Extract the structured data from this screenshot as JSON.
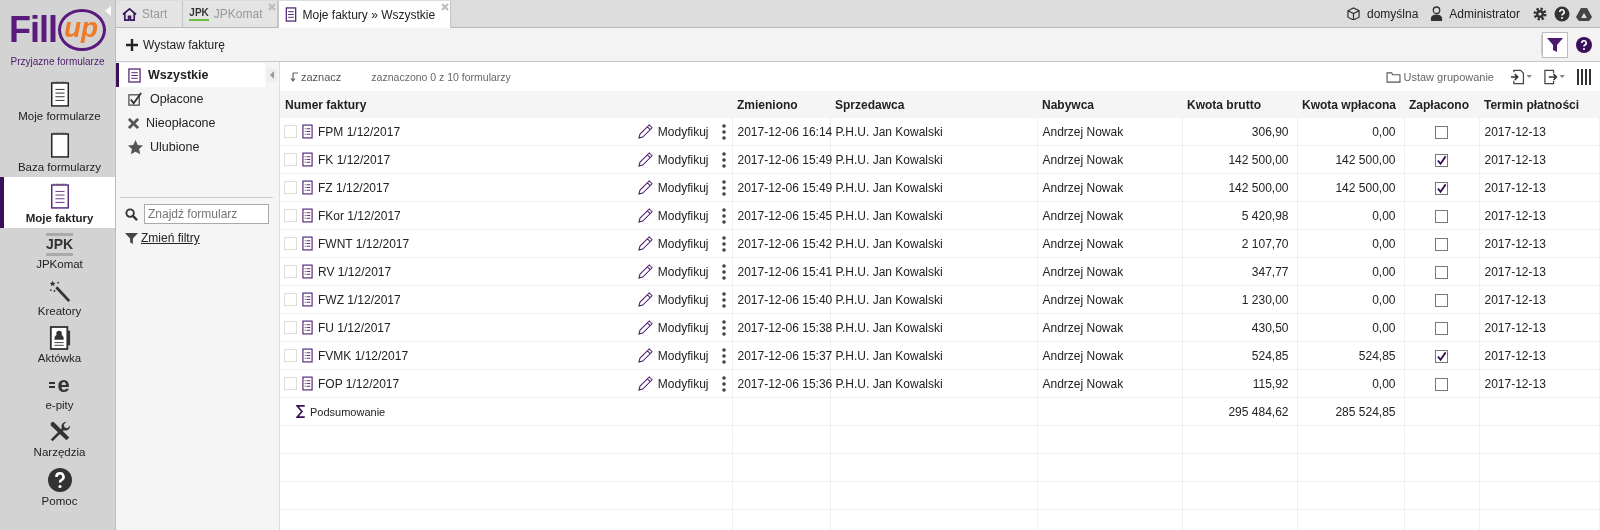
{
  "logo": {
    "word": "Fill",
    "accent": "up",
    "tagline": "Przyjazne formularze"
  },
  "nav": [
    {
      "kind": "forms",
      "label": "Moje formularze",
      "selected": false
    },
    {
      "kind": "database",
      "label": "Baza formularzy",
      "selected": false
    },
    {
      "kind": "invoices",
      "label": "Moje faktury",
      "selected": true
    },
    {
      "kind": "jpk",
      "badge": "JPK",
      "label": "JPKomat",
      "selected": false
    },
    {
      "kind": "wizard",
      "label": "Kreatory",
      "selected": false
    },
    {
      "kind": "briefcase",
      "label": "Aktówka",
      "selected": false
    },
    {
      "kind": "epity",
      "badge": "e",
      "label": "e-pity",
      "selected": false
    },
    {
      "kind": "tools",
      "label": "Narzędzia",
      "selected": false
    },
    {
      "kind": "help",
      "label": "Pomoc",
      "selected": false
    }
  ],
  "tabs": [
    {
      "kind": "home",
      "label": "Start",
      "selected": false,
      "closable": false
    },
    {
      "kind": "jpk",
      "badge": "JPK",
      "label": "JPKomat",
      "selected": false,
      "closable": true
    },
    {
      "kind": "doc",
      "label": "Moje faktury » Wszystkie",
      "selected": true,
      "closable": true
    }
  ],
  "top_right": {
    "profile": "domyślna",
    "user": "Administrator"
  },
  "toolbar": {
    "new_button": "Wystaw fakturę"
  },
  "filters": [
    {
      "kind": "doc",
      "label": "Wszystkie",
      "selected": true
    },
    {
      "kind": "check",
      "label": "Opłacone",
      "selected": false
    },
    {
      "kind": "cross",
      "label": "Nieopłacone",
      "selected": false
    },
    {
      "kind": "star",
      "label": "Ulubione",
      "selected": false
    }
  ],
  "search": {
    "placeholder": "Znajdź formularz"
  },
  "change_filters": "Zmień filtry",
  "list_bar": {
    "select": "zaznacz",
    "count": "zaznaczono 0 z 10 formularzy",
    "grouping": "Ustaw grupowanie"
  },
  "table": {
    "columns": [
      "Numer faktury",
      "Zmieniono",
      "Sprzedawca",
      "Nabywca",
      "Kwota brutto",
      "Kwota wpłacona",
      "Zapłacono",
      "Termin płatności"
    ],
    "rows": [
      {
        "checked": false,
        "number": "FPM 1/12/2017",
        "action": "Modyfikuj",
        "changed": "2017-12-06 16:14",
        "seller": "P.H.U. Jan Kowalski",
        "buyer": "Andrzej Nowak",
        "gross": "306,90",
        "paid": "0,00",
        "paid_flag": false,
        "due": "2017-12-13"
      },
      {
        "checked": false,
        "number": "FK 1/12/2017",
        "action": "Modyfikuj",
        "changed": "2017-12-06 15:49",
        "seller": "P.H.U. Jan Kowalski",
        "buyer": "Andrzej Nowak",
        "gross": "142 500,00",
        "paid": "142 500,00",
        "paid_flag": true,
        "due": "2017-12-13"
      },
      {
        "checked": false,
        "number": "FZ 1/12/2017",
        "action": "Modyfikuj",
        "changed": "2017-12-06 15:49",
        "seller": "P.H.U. Jan Kowalski",
        "buyer": "Andrzej Nowak",
        "gross": "142 500,00",
        "paid": "142 500,00",
        "paid_flag": true,
        "due": "2017-12-13"
      },
      {
        "checked": false,
        "number": "FKor 1/12/2017",
        "action": "Modyfikuj",
        "changed": "2017-12-06 15:45",
        "seller": "P.H.U. Jan Kowalski",
        "buyer": "Andrzej Nowak",
        "gross": "5 420,98",
        "paid": "0,00",
        "paid_flag": false,
        "due": "2017-12-13"
      },
      {
        "checked": false,
        "number": "FWNT 1/12/2017",
        "action": "Modyfikuj",
        "changed": "2017-12-06 15:42",
        "seller": "P.H.U. Jan Kowalski",
        "buyer": "Andrzej Nowak",
        "gross": "2 107,70",
        "paid": "0,00",
        "paid_flag": false,
        "due": "2017-12-13"
      },
      {
        "checked": false,
        "number": "RV 1/12/2017",
        "action": "Modyfikuj",
        "changed": "2017-12-06 15:41",
        "seller": "P.H.U. Jan Kowalski",
        "buyer": "Andrzej Nowak",
        "gross": "347,77",
        "paid": "0,00",
        "paid_flag": false,
        "due": "2017-12-13"
      },
      {
        "checked": false,
        "number": "FWZ 1/12/2017",
        "action": "Modyfikuj",
        "changed": "2017-12-06 15:40",
        "seller": "P.H.U. Jan Kowalski",
        "buyer": "Andrzej Nowak",
        "gross": "1 230,00",
        "paid": "0,00",
        "paid_flag": false,
        "due": "2017-12-13"
      },
      {
        "checked": false,
        "number": "FU 1/12/2017",
        "action": "Modyfikuj",
        "changed": "2017-12-06 15:38",
        "seller": "P.H.U. Jan Kowalski",
        "buyer": "Andrzej Nowak",
        "gross": "430,50",
        "paid": "0,00",
        "paid_flag": false,
        "due": "2017-12-13"
      },
      {
        "checked": false,
        "number": "FVMK 1/12/2017",
        "action": "Modyfikuj",
        "changed": "2017-12-06 15:37",
        "seller": "P.H.U. Jan Kowalski",
        "buyer": "Andrzej Nowak",
        "gross": "524,85",
        "paid": "524,85",
        "paid_flag": true,
        "due": "2017-12-13"
      },
      {
        "checked": false,
        "number": "FOP 1/12/2017",
        "action": "Modyfikuj",
        "changed": "2017-12-06 15:36",
        "seller": "P.H.U. Jan Kowalski",
        "buyer": "Andrzej Nowak",
        "gross": "115,92",
        "paid": "0,00",
        "paid_flag": false,
        "due": "2017-12-13"
      }
    ],
    "summary": {
      "label": "Podsumowanie",
      "gross": "295 484,62",
      "paid": "285 524,85"
    }
  }
}
